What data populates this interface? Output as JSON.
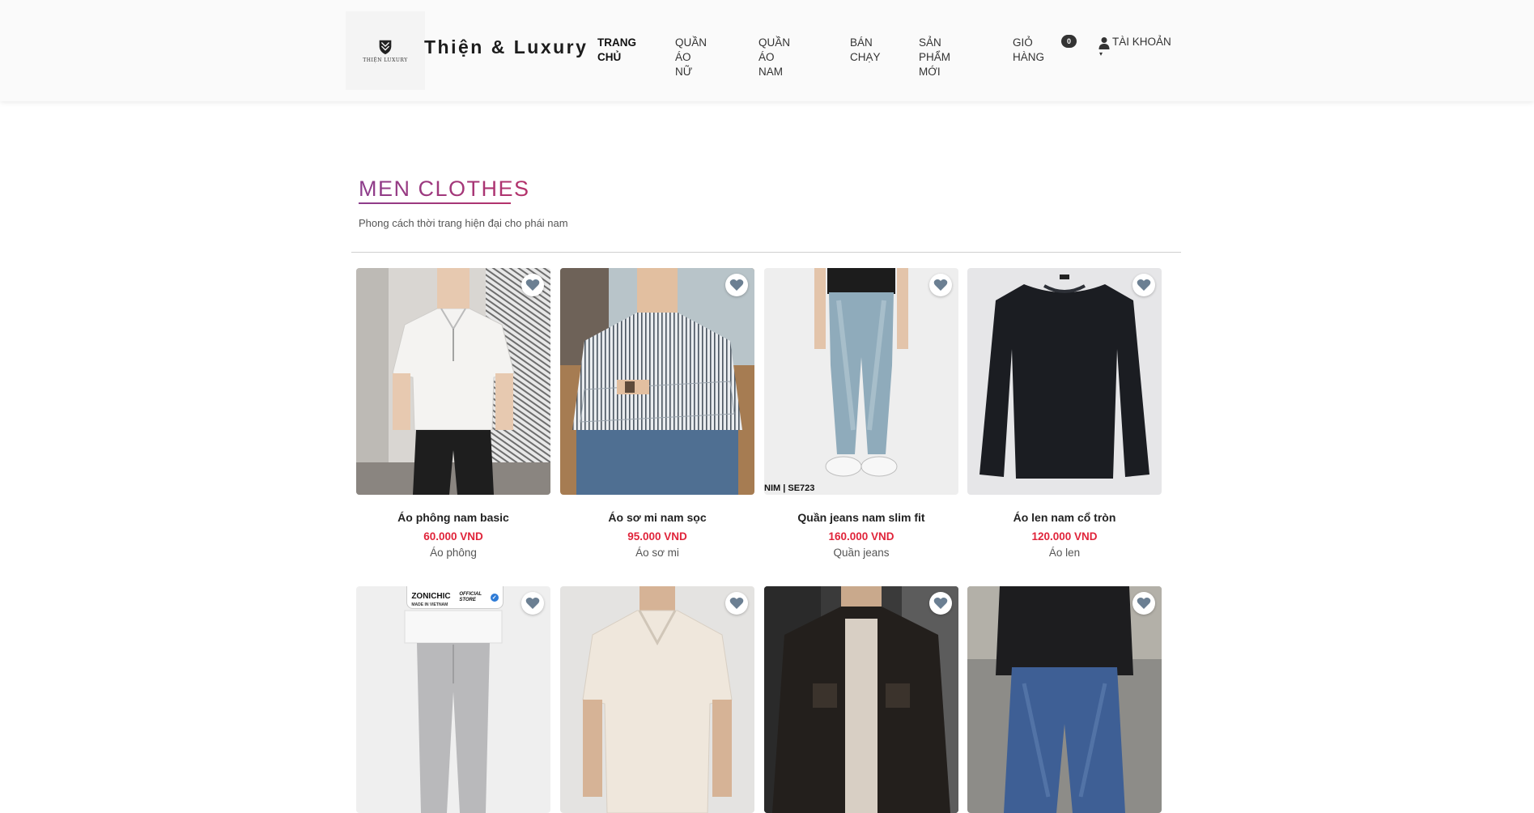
{
  "header": {
    "logo_text": "THIỆN LUXURY",
    "brand": "Thiện & Luxury",
    "nav": [
      {
        "line1": "TRANG",
        "line2": "CHỦ"
      },
      {
        "line1": "QUẦN ÁO",
        "line2": "NỮ"
      },
      {
        "line1": "QUẦN ÁO",
        "line2": "NAM"
      },
      {
        "line1": "BÁN",
        "line2": "CHẠY"
      },
      {
        "line1": "SẢN PHẨM",
        "line2": "MỚI"
      },
      {
        "line1": "GIỎ",
        "line2": "HÀNG"
      }
    ],
    "cart_count": "0",
    "account_label": "TÀI KHOẢN",
    "account_caret": "▾"
  },
  "section": {
    "title": "MEN CLOTHES",
    "subtitle": "Phong cách thời trang hiện đại cho phái nam"
  },
  "products": [
    {
      "name": "Áo phông nam basic",
      "price": "60.000 VND",
      "category": "Áo phông"
    },
    {
      "name": "Áo sơ mi nam sọc",
      "price": "95.000 VND",
      "category": "Áo sơ mi"
    },
    {
      "name": "Quần jeans nam slim fit",
      "price": "160.000 VND",
      "category": "Quần jeans",
      "image_caption": "NIM | SE723"
    },
    {
      "name": "Áo len nam cổ tròn",
      "price": "120.000 VND",
      "category": "Áo len"
    },
    {
      "store_badge": {
        "name": "ZONICHIC",
        "sub": "MADE IN VIETNAM",
        "official": "OFFICIAL",
        "store": "STORE"
      }
    },
    {},
    {},
    {}
  ],
  "colors": {
    "accent_gradient_start": "#8c3d8c",
    "accent_gradient_end": "#b5326a",
    "price": "#e0243a",
    "heart": "#6b7f92"
  },
  "icons": {
    "favorite": "heart-icon",
    "account": "user-icon",
    "logo": "crest-logo-icon"
  }
}
